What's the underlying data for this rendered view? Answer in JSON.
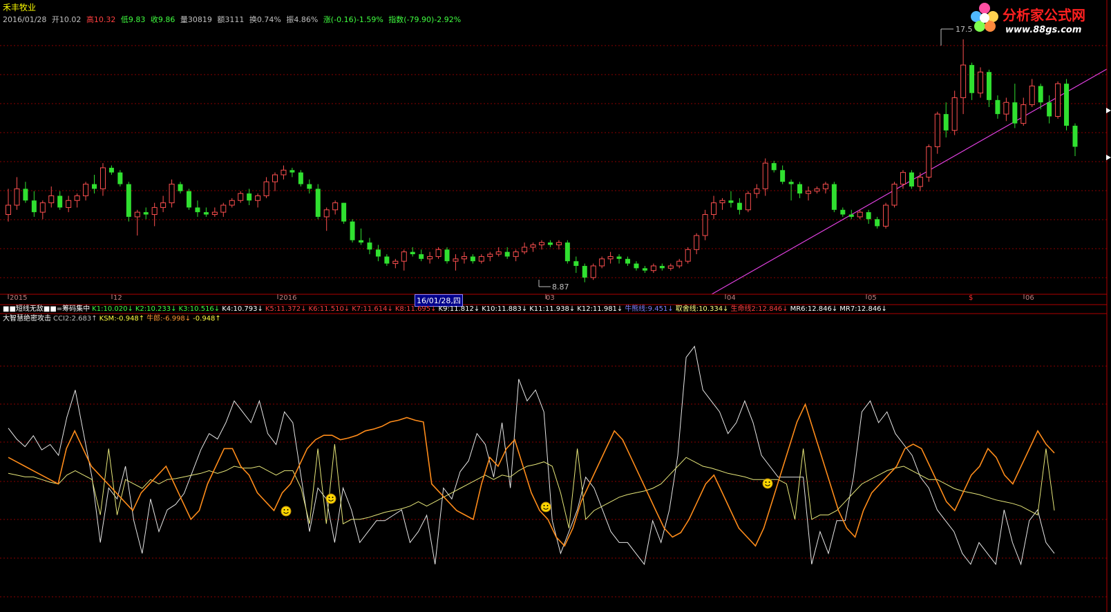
{
  "stock": {
    "name": "禾丰牧业",
    "date": "2016/01/28",
    "open": "开10.02",
    "high": "高10.32",
    "low": "低9.83",
    "close": "收9.86",
    "volume": "量30819",
    "amount": "额3111",
    "turnover": "换0.74%",
    "amplitude": "振4.86%",
    "change": "涨(-0.16)-1.59%",
    "index": "指数(-79.90)-2.92%"
  },
  "logo": {
    "title": "分析家公式网",
    "url": "www.88gs.com"
  },
  "price_labels": {
    "high": "17.5",
    "low": "8.87"
  },
  "time_axis": {
    "ticks": [
      "2015",
      "12",
      "2016",
      "03",
      "04",
      "05",
      "06"
    ],
    "cursor_label": "16/01/28,四",
    "marker": "$"
  },
  "ma_legend": [
    {
      "text": "■■短线无敌■■=筹码集中",
      "color": "#ffffff"
    },
    {
      "text": "K1:10.020↓",
      "color": "#40ff40"
    },
    {
      "text": "K2:10.233↓",
      "color": "#40ff40"
    },
    {
      "text": "K3:10.516↓",
      "color": "#40ff40"
    },
    {
      "text": "K4:10.793↓",
      "color": "#ffffff"
    },
    {
      "text": "K5:11.372↓",
      "color": "#ff4040"
    },
    {
      "text": "K6:11.510↓",
      "color": "#ff4040"
    },
    {
      "text": "K7:11.614↓",
      "color": "#ff4040"
    },
    {
      "text": "K8:11.695↓",
      "color": "#ff4040"
    },
    {
      "text": "K9:11.812↓",
      "color": "#ffffff"
    },
    {
      "text": "K10:11.883↓",
      "color": "#ffffff"
    },
    {
      "text": "K11:11.938↓",
      "color": "#ffffff"
    },
    {
      "text": "K12:11.981↓",
      "color": "#ffffff"
    },
    {
      "text": "牛熊线:9.451↓",
      "color": "#8080ff"
    },
    {
      "text": "取舍线:10.334↓",
      "color": "#ffff80"
    },
    {
      "text": "生命线2:12.846↓",
      "color": "#ff4040"
    },
    {
      "text": "MR6:12.846↓",
      "color": "#ffffff"
    },
    {
      "text": "MR7:12.846↓",
      "color": "#ffffff"
    }
  ],
  "indicator_legend": [
    {
      "text": "大智慧绝密攻击",
      "color": "#ffffff"
    },
    {
      "text": "CCI2:2.683↑",
      "color": "#c0c0c0"
    },
    {
      "text": "KSM:-0.948↑",
      "color": "#ffff40"
    },
    {
      "text": "牛郎:-6.998↓",
      "color": "#ff9933"
    },
    {
      "text": "-0.948↑",
      "color": "#ffff40"
    }
  ],
  "colors": {
    "up": "#ff5050",
    "down": "#30e030",
    "trendline": "#e040e0",
    "white_line": "#e8e8e8",
    "yellow_line": "#e8e87a",
    "orange_line": "#ff8c1a",
    "grid": "#8b0000"
  },
  "chart_data": {
    "type": "candlestick-with-indicators",
    "candles": [
      [
        10.0,
        11.1,
        9.7,
        10.4
      ],
      [
        10.4,
        11.6,
        10.2,
        11.1
      ],
      [
        11.1,
        11.4,
        10.5,
        10.6
      ],
      [
        10.6,
        11.0,
        9.9,
        10.1
      ],
      [
        10.1,
        10.6,
        9.8,
        10.5
      ],
      [
        10.5,
        11.2,
        10.3,
        10.8
      ],
      [
        10.8,
        11.0,
        10.2,
        10.3
      ],
      [
        10.3,
        10.8,
        10.1,
        10.6
      ],
      [
        10.6,
        10.9,
        10.3,
        10.8
      ],
      [
        10.8,
        11.4,
        10.6,
        11.3
      ],
      [
        11.3,
        11.7,
        10.9,
        11.1
      ],
      [
        11.1,
        12.2,
        10.8,
        12.0
      ],
      [
        12.0,
        12.1,
        11.7,
        11.8
      ],
      [
        11.8,
        11.9,
        11.2,
        11.3
      ],
      [
        11.3,
        11.4,
        9.7,
        9.9
      ],
      [
        9.9,
        10.2,
        9.1,
        10.1
      ],
      [
        10.1,
        10.3,
        9.8,
        10.0
      ],
      [
        10.0,
        10.5,
        9.5,
        10.3
      ],
      [
        10.3,
        10.8,
        10.1,
        10.5
      ],
      [
        10.5,
        11.5,
        10.3,
        11.3
      ],
      [
        11.3,
        11.4,
        10.9,
        11.0
      ],
      [
        11.0,
        11.1,
        10.2,
        10.3
      ],
      [
        10.3,
        10.6,
        9.9,
        10.1
      ],
      [
        10.1,
        10.3,
        9.9,
        10.0
      ],
      [
        10.0,
        10.3,
        9.9,
        10.1
      ],
      [
        10.1,
        10.5,
        9.9,
        10.4
      ],
      [
        10.4,
        10.7,
        10.3,
        10.6
      ],
      [
        10.6,
        11.0,
        10.5,
        10.9
      ],
      [
        10.9,
        11.1,
        10.4,
        10.6
      ],
      [
        10.6,
        10.9,
        10.3,
        10.8
      ],
      [
        10.8,
        11.6,
        10.7,
        11.4
      ],
      [
        11.4,
        11.8,
        11.0,
        11.7
      ],
      [
        11.7,
        12.1,
        11.5,
        11.9
      ],
      [
        11.9,
        12.0,
        11.6,
        11.8
      ],
      [
        11.8,
        11.9,
        11.2,
        11.3
      ],
      [
        11.3,
        11.5,
        10.9,
        11.1
      ],
      [
        11.1,
        11.3,
        9.8,
        9.9
      ],
      [
        9.9,
        10.3,
        9.3,
        10.2
      ],
      [
        10.2,
        10.6,
        10.0,
        10.5
      ],
      [
        10.5,
        10.5,
        9.6,
        9.7
      ],
      [
        9.7,
        9.8,
        8.8,
        8.9
      ],
      [
        8.9,
        9.4,
        8.7,
        8.8
      ],
      [
        8.8,
        9.0,
        8.3,
        8.5
      ],
      [
        8.5,
        8.7,
        8.0,
        8.2
      ],
      [
        8.2,
        8.3,
        7.8,
        7.9
      ],
      [
        7.9,
        8.1,
        7.7,
        8.0
      ],
      [
        8.0,
        8.5,
        7.6,
        8.4
      ],
      [
        8.4,
        8.6,
        8.2,
        8.3
      ],
      [
        8.3,
        8.5,
        8.0,
        8.1
      ],
      [
        8.1,
        8.4,
        7.9,
        8.2
      ],
      [
        8.2,
        8.6,
        8.1,
        8.5
      ],
      [
        8.5,
        8.6,
        7.9,
        8.0
      ],
      [
        8.0,
        8.3,
        7.6,
        8.1
      ],
      [
        8.1,
        8.4,
        7.9,
        8.2
      ],
      [
        8.2,
        8.3,
        7.9,
        8.0
      ],
      [
        8.0,
        8.3,
        7.9,
        8.2
      ],
      [
        8.2,
        8.4,
        8.0,
        8.3
      ],
      [
        8.3,
        8.6,
        8.2,
        8.4
      ],
      [
        8.4,
        8.6,
        8.1,
        8.2
      ],
      [
        8.2,
        8.5,
        8.0,
        8.4
      ],
      [
        8.4,
        8.8,
        8.3,
        8.6
      ],
      [
        8.6,
        8.8,
        8.4,
        8.7
      ],
      [
        8.7,
        8.9,
        8.5,
        8.8
      ],
      [
        8.8,
        8.9,
        8.6,
        8.7
      ],
      [
        8.7,
        8.9,
        8.5,
        8.8
      ],
      [
        8.8,
        8.9,
        7.9,
        8.0
      ],
      [
        8.0,
        8.2,
        7.5,
        7.8
      ],
      [
        7.8,
        7.9,
        7.1,
        7.3
      ],
      [
        7.3,
        7.9,
        7.2,
        7.8
      ],
      [
        7.8,
        8.2,
        7.7,
        8.1
      ],
      [
        8.1,
        8.4,
        7.9,
        8.2
      ],
      [
        8.2,
        8.3,
        7.9,
        8.1
      ],
      [
        8.1,
        8.2,
        7.8,
        7.9
      ],
      [
        7.9,
        8.0,
        7.6,
        7.7
      ],
      [
        7.7,
        7.8,
        7.5,
        7.6
      ],
      [
        7.6,
        7.9,
        7.5,
        7.8
      ],
      [
        7.8,
        7.9,
        7.6,
        7.7
      ],
      [
        7.7,
        7.9,
        7.6,
        7.8
      ],
      [
        7.8,
        8.1,
        7.7,
        8.0
      ],
      [
        8.0,
        8.6,
        7.9,
        8.5
      ],
      [
        8.5,
        9.2,
        8.3,
        9.1
      ],
      [
        9.1,
        10.2,
        8.9,
        10.0
      ],
      [
        10.0,
        10.8,
        9.8,
        10.5
      ],
      [
        10.5,
        10.7,
        10.2,
        10.6
      ],
      [
        10.6,
        11.0,
        10.3,
        10.5
      ],
      [
        10.5,
        10.7,
        10.0,
        10.2
      ],
      [
        10.2,
        11.0,
        10.1,
        10.9
      ],
      [
        10.9,
        11.3,
        10.7,
        11.1
      ],
      [
        11.1,
        12.4,
        10.8,
        12.2
      ],
      [
        12.2,
        12.3,
        11.8,
        11.9
      ],
      [
        11.9,
        12.1,
        11.3,
        11.4
      ],
      [
        11.4,
        11.5,
        10.6,
        11.3
      ],
      [
        11.3,
        11.4,
        10.7,
        10.9
      ],
      [
        10.9,
        11.2,
        10.6,
        11.0
      ],
      [
        11.0,
        11.2,
        10.9,
        11.1
      ],
      [
        11.1,
        11.4,
        10.9,
        11.3
      ],
      [
        11.3,
        11.4,
        10.1,
        10.2
      ],
      [
        10.2,
        10.3,
        9.9,
        10.0
      ],
      [
        10.0,
        10.2,
        9.8,
        9.9
      ],
      [
        9.9,
        10.2,
        9.8,
        10.1
      ],
      [
        10.1,
        10.2,
        9.6,
        9.8
      ],
      [
        9.8,
        9.9,
        9.4,
        9.5
      ],
      [
        9.5,
        10.5,
        9.4,
        10.4
      ],
      [
        10.4,
        11.4,
        10.3,
        11.3
      ],
      [
        11.3,
        11.9,
        11.1,
        11.8
      ],
      [
        11.8,
        11.9,
        11.1,
        11.2
      ],
      [
        11.2,
        11.8,
        11.0,
        11.6
      ],
      [
        11.6,
        13.0,
        11.4,
        12.9
      ],
      [
        12.9,
        14.4,
        12.6,
        14.3
      ],
      [
        14.3,
        14.8,
        13.3,
        13.6
      ],
      [
        13.6,
        15.3,
        13.4,
        15.0
      ],
      [
        15.0,
        17.5,
        14.3,
        16.4
      ],
      [
        16.4,
        16.5,
        14.9,
        15.2
      ],
      [
        15.2,
        16.3,
        15.0,
        16.1
      ],
      [
        16.1,
        16.2,
        14.6,
        14.9
      ],
      [
        14.9,
        15.1,
        14.1,
        14.3
      ],
      [
        14.3,
        15.0,
        14.0,
        14.8
      ],
      [
        14.8,
        15.6,
        13.7,
        13.9
      ],
      [
        13.9,
        15.0,
        13.8,
        14.7
      ],
      [
        14.7,
        15.8,
        14.6,
        15.5
      ],
      [
        15.5,
        15.6,
        14.5,
        14.8
      ],
      [
        14.8,
        15.1,
        13.9,
        14.2
      ],
      [
        14.2,
        15.7,
        14.1,
        15.6
      ],
      [
        15.6,
        15.8,
        13.6,
        13.8
      ],
      [
        13.8,
        13.9,
        12.5,
        12.9
      ]
    ],
    "price_range": [
      7.0,
      18.0
    ],
    "cci2": [
      85,
      75,
      68,
      78,
      65,
      70,
      60,
      95,
      120,
      80,
      40,
      -20,
      30,
      20,
      50,
      0,
      -30,
      20,
      -10,
      10,
      15,
      25,
      45,
      65,
      80,
      75,
      90,
      110,
      100,
      90,
      110,
      80,
      70,
      100,
      90,
      40,
      -10,
      30,
      20,
      -20,
      30,
      10,
      -20,
      -10,
      0,
      0,
      5,
      10,
      -20,
      -10,
      5,
      -40,
      30,
      20,
      45,
      55,
      80,
      70,
      40,
      90,
      30,
      130,
      110,
      120,
      100,
      0,
      -30,
      -10,
      10,
      40,
      30,
      10,
      -10,
      -20,
      -20,
      -30,
      -40,
      0,
      -20,
      10,
      60,
      150,
      160,
      120,
      110,
      100,
      80,
      90,
      110,
      90,
      60,
      50,
      40,
      40,
      40,
      40,
      -40,
      -10,
      -30,
      0,
      0,
      40,
      100,
      110,
      90,
      100,
      80,
      70,
      60,
      40,
      30,
      10,
      0,
      -10,
      -30,
      -40,
      -20,
      -30,
      -40,
      10,
      -20,
      -40,
      0,
      10,
      -20,
      -30
    ],
    "ksm": [
      12,
      10,
      8,
      8,
      5,
      2,
      0,
      10,
      15,
      10,
      5,
      -35,
      40,
      -35,
      5,
      0,
      -5,
      5,
      0,
      5,
      6,
      8,
      10,
      12,
      15,
      12,
      15,
      20,
      18,
      18,
      20,
      15,
      10,
      15,
      15,
      -5,
      -45,
      40,
      -45,
      45,
      -45,
      -40,
      -40,
      -38,
      -35,
      -32,
      -30,
      -28,
      -25,
      -20,
      -25,
      -20,
      -15,
      -10,
      -5,
      0,
      5,
      10,
      5,
      10,
      8,
      15,
      20,
      22,
      25,
      20,
      -10,
      -50,
      40,
      -40,
      -30,
      -25,
      -20,
      -15,
      -12,
      -10,
      -8,
      -5,
      0,
      10,
      20,
      30,
      25,
      20,
      18,
      15,
      12,
      10,
      8,
      5,
      5,
      5,
      5,
      0,
      -40,
      40,
      -40,
      -35,
      -35,
      -30,
      -20,
      -10,
      0,
      5,
      10,
      15,
      18,
      20,
      15,
      10,
      5,
      5,
      0,
      -5,
      -8,
      -10,
      -12,
      -15,
      -18,
      -20,
      -22,
      -25,
      -30,
      -35,
      40,
      -30
    ],
    "niulang": [
      -70,
      -75,
      -80,
      -85,
      -90,
      -95,
      -100,
      -60,
      -40,
      -60,
      -80,
      -90,
      -100,
      -110,
      -120,
      -130,
      -110,
      -100,
      -90,
      -80,
      -100,
      -120,
      -140,
      -130,
      -100,
      -80,
      -60,
      -60,
      -80,
      -90,
      -110,
      -120,
      -130,
      -110,
      -100,
      -80,
      -60,
      -50,
      -45,
      -45,
      -50,
      -48,
      -45,
      -40,
      -38,
      -35,
      -30,
      -28,
      -25,
      -28,
      -30,
      -100,
      -110,
      -120,
      -130,
      -135,
      -140,
      -100,
      -70,
      -80,
      -60,
      -50,
      -80,
      -110,
      -130,
      -140,
      -160,
      -170,
      -150,
      -120,
      -100,
      -80,
      -60,
      -40,
      -50,
      -70,
      -90,
      -110,
      -130,
      -150,
      -160,
      -155,
      -140,
      -120,
      -100,
      -90,
      -110,
      -130,
      -150,
      -160,
      -170,
      -150,
      -120,
      -90,
      -60,
      -30,
      -10,
      -40,
      -70,
      -100,
      -130,
      -150,
      -160,
      -130,
      -110,
      -100,
      -90,
      -80,
      -60,
      -55,
      -60,
      -80,
      -100,
      -120,
      -130,
      -110,
      -90,
      -80,
      -60,
      -70,
      -90,
      -100,
      -80,
      -60,
      -40,
      -55,
      -65
    ]
  }
}
